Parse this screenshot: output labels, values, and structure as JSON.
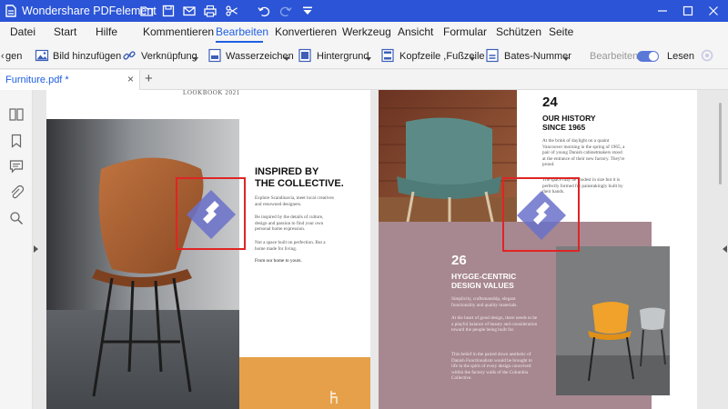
{
  "titlebar": {
    "app_title": "Wondershare PDFelement",
    "quick_access_icons": [
      "folder-icon",
      "save-icon",
      "mail-icon",
      "print-icon",
      "scissors-icon",
      "undo-icon",
      "redo-icon",
      "dropdown-icon"
    ],
    "window_buttons": [
      "minimize-icon",
      "maximize-icon",
      "close-icon"
    ],
    "color": "#2b54d6"
  },
  "menu": {
    "items": [
      "Datei",
      "Start",
      "Hilfe",
      "Kommentieren",
      "Bearbeiten",
      "Konvertieren",
      "Werkzeug",
      "Ansicht",
      "Formular",
      "Schützen",
      "Seite"
    ],
    "active": "Bearbeiten"
  },
  "toolbar": {
    "scroll_left": "‹",
    "items": [
      {
        "label": "gen",
        "icon": ""
      },
      {
        "label": "Bild hinzufügen",
        "icon": "image-icon"
      },
      {
        "label": "Verknüpfung",
        "icon": "link-icon"
      },
      {
        "label": "Wasserzeichen",
        "icon": "watermark-icon"
      },
      {
        "label": "Hintergrund",
        "icon": "background-icon"
      },
      {
        "label": "Kopfzeile ,Fußzeile",
        "icon": "header-footer-icon"
      },
      {
        "label": "Bates-Nummer",
        "icon": "bates-icon"
      }
    ],
    "edit_label": "Bearbeiten",
    "read_label": "Lesen",
    "toggle_on": true
  },
  "tabs": {
    "doc_tab": "Furniture.pdf *",
    "close": "×",
    "new_tab": "+"
  },
  "sidebar": {
    "icons": [
      "thumbnails-icon",
      "bookmark-icon",
      "comment-icon",
      "attachment-icon",
      "search-icon"
    ]
  },
  "page_left": {
    "header": "LOOKBOOK 2021",
    "heading": "INSPIRED BY\nTHE COLLECTIVE.",
    "body1": "Explore Scandinavia, meet local creatives and renowned designers.",
    "body2": "Be inspired by the details of culture, design and passion to find your own personal home expression.",
    "body3": "Not a space built on perfection. But a home made for living.",
    "body4": "From our home to yours."
  },
  "page_right": {
    "num1": "24",
    "title1": "OUR HISTORY\nSINCE 1965",
    "body1": "At the brink of daylight on a quaint Vancouver morning in the spring of 1965, a pair of young Danish cabinetmakers stood at the entrance of their new factory. They're proud.",
    "body2": "The space may be modest in size but it is perfectly formed for painstakingly built by their hands.",
    "num2": "26",
    "title2": "HYGGE-CENTRIC\nDESIGN VALUES",
    "body3": "Simplicity, craftsmanship, elegant functionality and quality materials.",
    "body4": "At the heart of good design, there needs to be a playful balance of beauty and consideration toward the people being built for.",
    "body5": "This belief in the paired down aesthetic of Danish Functionalism would be brought to life in the spirit of every design conceived within the factory walls of the Columbia Collective."
  },
  "colors": {
    "accent": "#1f5ee0",
    "watermark_box": "#e02424",
    "watermark_logo": "#6a71c9",
    "mauve_panel": "#a78890",
    "orange_block": "#e6a04a"
  }
}
